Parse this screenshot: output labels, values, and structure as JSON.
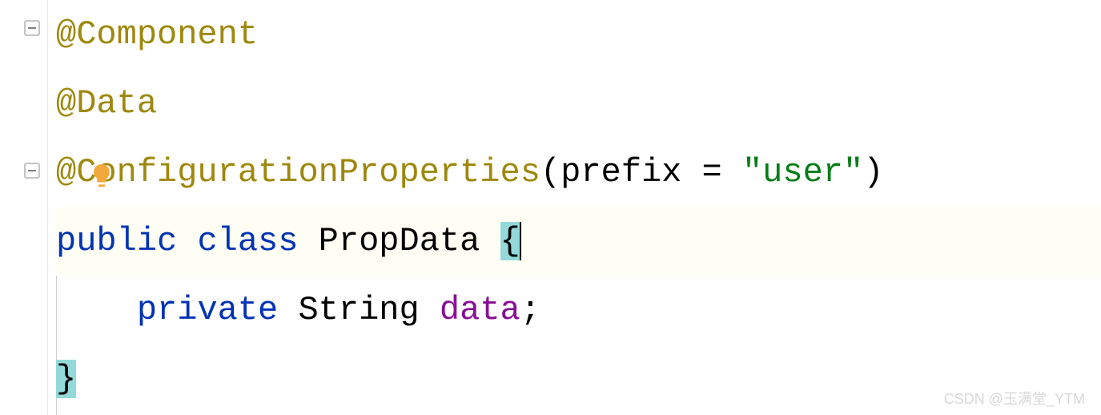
{
  "code": {
    "line1": {
      "annotation": "@Component"
    },
    "line2": {
      "annotation": "@Data"
    },
    "line3": {
      "annotation": "@ConfigurationProperties",
      "paren_open": "(",
      "param": "prefix = ",
      "string": "\"user\"",
      "paren_close": ")"
    },
    "line4": {
      "kw_public": "public ",
      "kw_class": "class ",
      "name": "PropData ",
      "brace": "{"
    },
    "line5": {
      "indent": "    ",
      "kw_private": "private ",
      "type": "String ",
      "field": "data",
      "semi": ";"
    },
    "line6": {
      "brace": "}"
    }
  },
  "icons": {
    "fold": "fold-minus",
    "bulb": "lightbulb"
  },
  "watermark": "CSDN @玉满堂_YTM"
}
